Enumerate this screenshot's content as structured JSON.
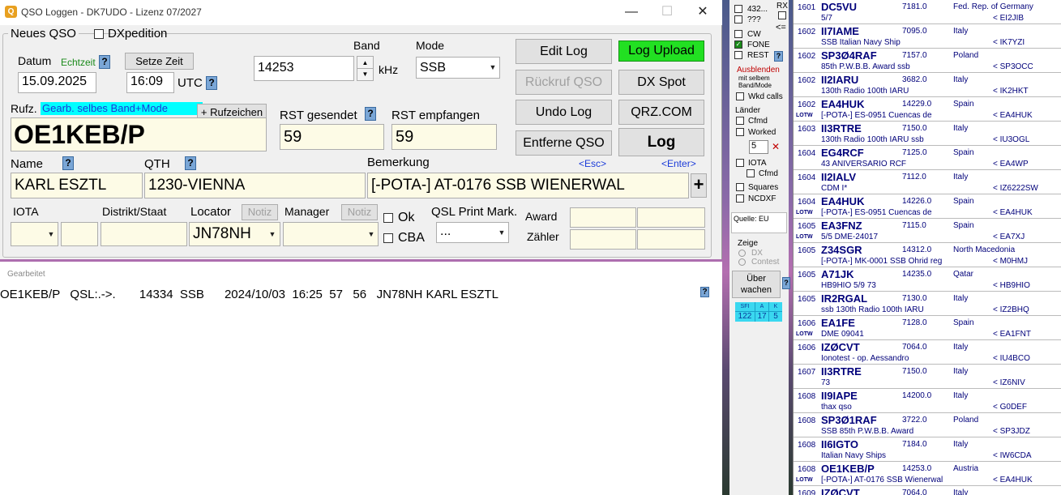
{
  "window": {
    "title": "QSO Loggen - DK7UDO - Lizenz 07/2027",
    "app_icon": "radio-icon",
    "minimize": "—",
    "maximize": "☐",
    "close": "✕"
  },
  "form": {
    "new_qso": "Neues QSO",
    "dxpedition": "DXpedition",
    "datum_label": "Datum",
    "echtzeit": "Echtzeit",
    "setze_zeit": "Setze Zeit",
    "date": "15.09.2025",
    "time": "16:09",
    "utc": "UTC",
    "band_label": "Band",
    "mode_label": "Mode",
    "frequency": "14253",
    "khz": "kHz",
    "mode": "SSB",
    "rufz_label": "Rufz.",
    "worked_hint": "Gearb. selbes Band+Mode",
    "rufzeichen_btn": "+ Rufzeichen",
    "callsign": "OE1KEB/P",
    "rst_sent_label": "RST gesendet",
    "rst_recv_label": "RST empfangen",
    "rst_sent": "59",
    "rst_recv": "59",
    "name_label": "Name",
    "qth_label": "QTH",
    "bemerkung_label": "Bemerkung",
    "esc": "<Esc>",
    "enter": "<Enter>",
    "name": "KARL ESZTL",
    "qth": "1230-VIENNA",
    "bemerkung": "[-POTA-] AT-0176 SSB WIENERWAL",
    "plus": "+",
    "iota_label": "IOTA",
    "distrikt_label": "Distrikt/Staat",
    "locator_label": "Locator",
    "notiz": "Notiz",
    "manager_label": "Manager",
    "locator": "JN78NH",
    "ok": "Ok",
    "cba": "CBA",
    "qsl_print_label": "QSL Print Mark.",
    "qsl_print_value": "...",
    "award_label": "Award",
    "zaehler_label": "Zähler",
    "help": "?"
  },
  "buttons": {
    "edit_log": "Edit Log",
    "log_upload": "Log Upload",
    "rueckruf": "Rückruf QSO",
    "dx_spot": "DX Spot",
    "undo_log": "Undo Log",
    "qrz": "QRZ.COM",
    "entferne": "Entferne QSO",
    "log": "Log"
  },
  "log": {
    "header": "Gearbeitet",
    "entry": "OE1KEB/P   QSL:.->.       14334  SSB      2024/10/03  16:25  57   56   JN78NH KARL ESZTL"
  },
  "side": {
    "b432": "432...",
    "bq": "???",
    "rx": "RX",
    "arrow": "<=",
    "cw": "CW",
    "fone": "FONE",
    "rest": "REST",
    "ausblenden": "Ausblenden",
    "mit_selbem": "mit selbem",
    "band_mode": "Band/Mode",
    "wkd_calls": "Wkd calls",
    "laender": "Länder",
    "cfmd": "Cfmd",
    "worked": "Worked",
    "count": "5",
    "x": "✕",
    "iota": "IOTA",
    "squares": "Squares",
    "ncdxf": "NCDXF",
    "quelle": "Quelle: EU",
    "zeige": "Zeige",
    "dx": "DX",
    "contest": "Contest",
    "ueber": "Über",
    "wachen": "wachen",
    "sfi_label": "SFI",
    "a_label": "A",
    "k_label": "K",
    "sfi": "122",
    "a": "17",
    "k": "5"
  },
  "spots": [
    {
      "time": "1601",
      "call": "DC5VU",
      "freq": "7181.0",
      "country": "Fed. Rep. of Germany",
      "comment": "5/7",
      "spotter": "< EI2JIB",
      "lotw": ""
    },
    {
      "time": "1602",
      "call": "II7IAME",
      "freq": "7095.0",
      "country": "Italy",
      "comment": "SSB Italian Navy Ship",
      "spotter": "< IK7YZI",
      "lotw": ""
    },
    {
      "time": "1602",
      "call": "SP3Ø4RAF",
      "freq": "7157.0",
      "country": "Poland",
      "comment": "85th P.W.B.B. Award ssb",
      "spotter": "< SP3OCC",
      "lotw": ""
    },
    {
      "time": "1602",
      "call": "II2IARU",
      "freq": "3682.0",
      "country": "Italy",
      "comment": "130th Radio 100th IARU",
      "spotter": "< IK2HKT",
      "lotw": ""
    },
    {
      "time": "1602",
      "call": "EA4HUK",
      "freq": "14229.0",
      "country": "Spain",
      "comment": "[-POTA-] ES-0951  Cuencas de",
      "spotter": "< EA4HUK",
      "lotw": "LOTW"
    },
    {
      "time": "1603",
      "call": "II3RTRE",
      "freq": "7150.0",
      "country": "Italy",
      "comment": "130th Radio 100th IARU ssb",
      "spotter": "< IU3OGL",
      "lotw": ""
    },
    {
      "time": "1604",
      "call": "EG4RCF",
      "freq": "7125.0",
      "country": "Spain",
      "comment": "43 ANIVERSARIO RCF",
      "spotter": "< EA4WP",
      "lotw": ""
    },
    {
      "time": "1604",
      "call": "II2IALV",
      "freq": "7112.0",
      "country": "Italy",
      "comment": "CDM I*",
      "spotter": "< IZ6222SW",
      "lotw": ""
    },
    {
      "time": "1604",
      "call": "EA4HUK",
      "freq": "14226.0",
      "country": "Spain",
      "comment": "[-POTA-] ES-0951  Cuencas de",
      "spotter": "< EA4HUK",
      "lotw": "LOTW"
    },
    {
      "time": "1605",
      "call": "EA3FNZ",
      "freq": "7115.0",
      "country": "Spain",
      "comment": "5/5  DME-24017",
      "spotter": "< EA7XJ",
      "lotw": "LOTW"
    },
    {
      "time": "1605",
      "call": "Z34SGR",
      "freq": "14312.0",
      "country": "North Macedonia",
      "comment": "[-POTA-] MK-0001 SSB Ohrid reg",
      "spotter": "< M0HMJ",
      "lotw": ""
    },
    {
      "time": "1605",
      "call": "A71JK",
      "freq": "14235.0",
      "country": "Qatar",
      "comment": "HB9HIO  5/9  73",
      "spotter": "< HB9HIO",
      "lotw": ""
    },
    {
      "time": "1605",
      "call": "IR2RGAL",
      "freq": "7130.0",
      "country": "Italy",
      "comment": "ssb 130th Radio 100th IARU",
      "spotter": "< IZ2BHQ",
      "lotw": ""
    },
    {
      "time": "1606",
      "call": "EA1FE",
      "freq": "7128.0",
      "country": "Spain",
      "comment": "DME 09041",
      "spotter": "< EA1FNT",
      "lotw": "LOTW"
    },
    {
      "time": "1606",
      "call": "IZØCVT",
      "freq": "7064.0",
      "country": "Italy",
      "comment": "Ionotest - op. Aessandro",
      "spotter": "< IU4BCO",
      "lotw": ""
    },
    {
      "time": "1607",
      "call": "II3RTRE",
      "freq": "7150.0",
      "country": "Italy",
      "comment": "73",
      "spotter": "< IZ6NIV",
      "lotw": ""
    },
    {
      "time": "1608",
      "call": "II9IAPE",
      "freq": "14200.0",
      "country": "Italy",
      "comment": "thax qso",
      "spotter": "< G0DEF",
      "lotw": ""
    },
    {
      "time": "1608",
      "call": "SP3Ø1RAF",
      "freq": "3722.0",
      "country": "Poland",
      "comment": "SSB 85th P.W.B.B. Award",
      "spotter": "< SP3JDZ",
      "lotw": ""
    },
    {
      "time": "1608",
      "call": "II6IGTO",
      "freq": "7184.0",
      "country": "Italy",
      "comment": "Italian Navy Ships",
      "spotter": "< IW6CDA",
      "lotw": ""
    },
    {
      "time": "1608",
      "call": "OE1KEB/P",
      "freq": "14253.0",
      "country": "Austria",
      "comment": "[-POTA-] AT-0176 SSB Wienerwal",
      "spotter": "< EA4HUK",
      "lotw": "LOTW"
    },
    {
      "time": "1609",
      "call": "IZØCVT",
      "freq": "7064.0",
      "country": "Italy",
      "comment": "",
      "spotter": "",
      "lotw": ""
    }
  ]
}
